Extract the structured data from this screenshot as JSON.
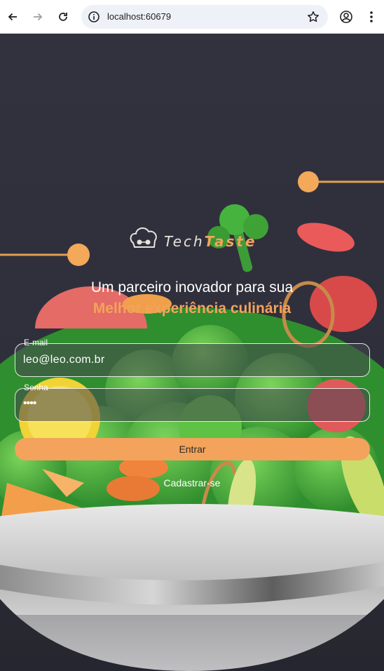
{
  "browser": {
    "url": "localhost:60679",
    "icons": [
      "back-arrow-icon",
      "forward-arrow-icon",
      "reload-icon",
      "site-info-icon",
      "bookmark-star-icon",
      "profile-icon",
      "menu-dots-icon"
    ]
  },
  "brand": {
    "name_part1": "Tech",
    "name_part2": "Taste",
    "accent": "#f3a35c"
  },
  "hero": {
    "headline": "Um parceiro inovador para sua",
    "subline": "Melhor experiência culinária"
  },
  "form": {
    "email_label": "E-mail",
    "email_value": "leo@leo.com.br",
    "password_label": "Senha",
    "password_value": "••••",
    "submit_label": "Entrar",
    "register_label": "Cadastrar-se"
  }
}
